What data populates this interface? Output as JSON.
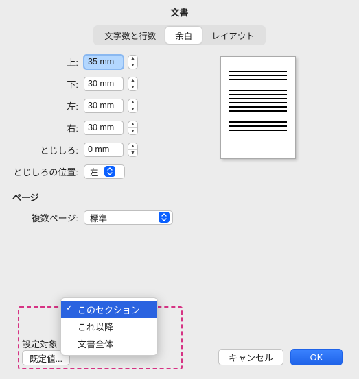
{
  "title": "文書",
  "tabs": {
    "chars": "文字数と行数",
    "margins": "余白",
    "layout": "レイアウト",
    "active": "余白"
  },
  "margins": {
    "top_label": "上:",
    "top_value": "35 mm",
    "bottom_label": "下:",
    "bottom_value": "30 mm",
    "left_label": "左:",
    "left_value": "30 mm",
    "right_label": "右:",
    "right_value": "30 mm",
    "gutter_label": "とじしろ:",
    "gutter_value": "0 mm",
    "gutter_pos_label": "とじしろの位置:",
    "gutter_pos_value": "左"
  },
  "pages": {
    "section_title": "ページ",
    "multi_label": "複数ページ:",
    "multi_value": "標準"
  },
  "apply": {
    "label": "設定対象",
    "options": [
      "このセクション",
      "これ以降",
      "文書全体"
    ],
    "selected": "このセクション"
  },
  "defaults_button": "既定値...",
  "cancel": "キャンセル",
  "ok": "OK"
}
